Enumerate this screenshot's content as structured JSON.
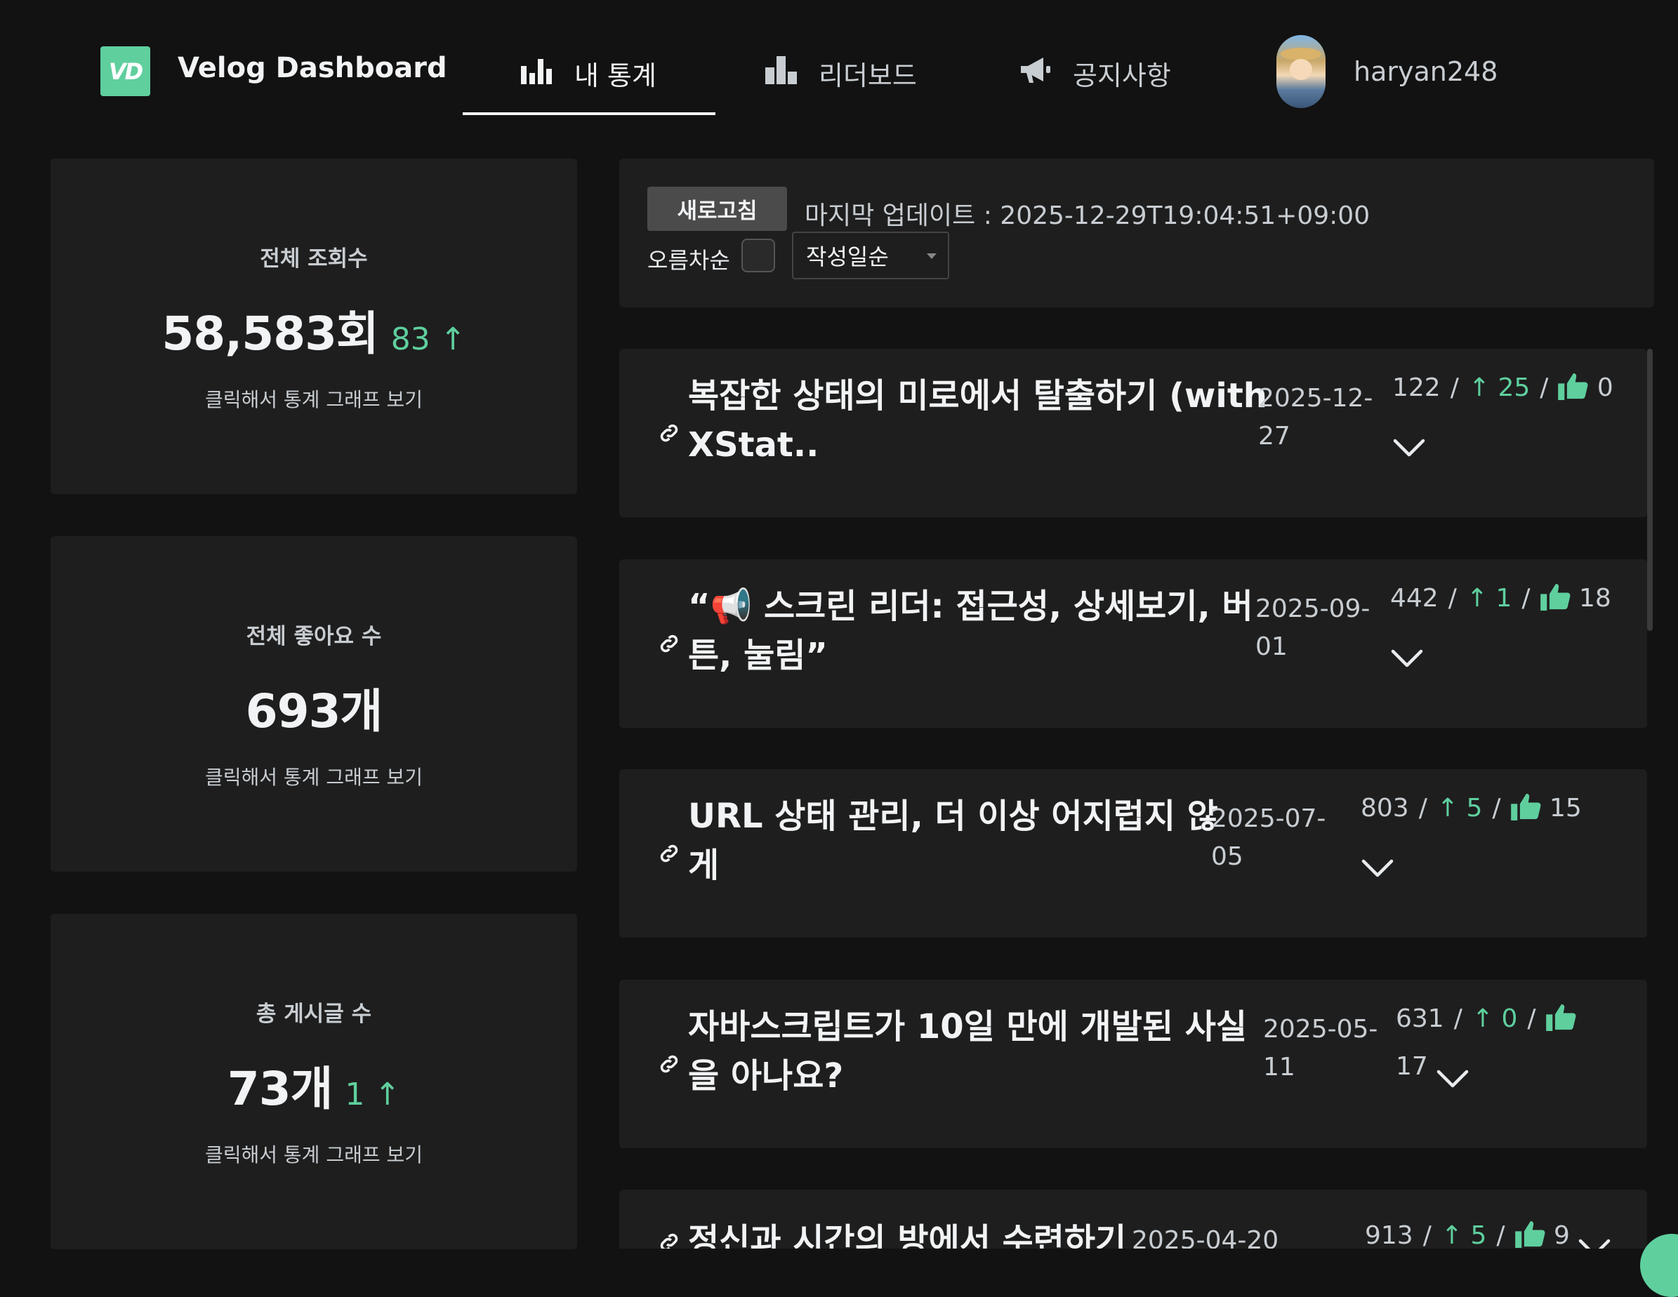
{
  "header": {
    "logo": "VD",
    "brand": "Velog Dashboard",
    "nav": [
      {
        "label": "내 통계",
        "icon": "bar-chart-icon"
      },
      {
        "label": "리더보드",
        "icon": "leaderboard-icon"
      },
      {
        "label": "공지사항",
        "icon": "megaphone-icon"
      }
    ],
    "username": "haryan248"
  },
  "stats": {
    "views": {
      "title": "전체 조회수",
      "value": "58,583회",
      "delta": "83 ↑",
      "hint": "클릭해서 통계 그래프 보기"
    },
    "likes": {
      "title": "전체 좋아요 수",
      "value": "693개",
      "hint": "클릭해서 통계 그래프 보기"
    },
    "posts": {
      "title": "총 게시글 수",
      "value": "73개",
      "delta": "1 ↑",
      "hint": "클릭해서 통계 그래프 보기"
    }
  },
  "controls": {
    "refresh_label": "새로고침",
    "last_update": "마지막 업데이트 : 2025-12-29T19:04:51+09:00",
    "asc_label": "오름차순",
    "sort_value": "작성일순"
  },
  "posts": [
    {
      "title_line1": "복잡한 상태의 미로에서 탈출하기 (with",
      "title_line2": "XStat..",
      "date_line1": "2025-12-",
      "date_line2": "27",
      "views": "122",
      "daily": "↑ 25",
      "likes": "0"
    },
    {
      "title_line1": "“📢 스크린 리더: 접근성, 상세보기, 버",
      "title_line2": "튼, 눌림”",
      "date_line1": "2025-09-",
      "date_line2": "01",
      "views": "442",
      "daily": "↑ 1",
      "likes": "18"
    },
    {
      "title_line1": "URL 상태 관리, 더 이상 어지럽지 않",
      "title_line2": "게",
      "date_line1": "2025-07-",
      "date_line2": "05",
      "views": "803",
      "daily": "↑ 5",
      "likes": "15"
    },
    {
      "title_line1": "자바스크립트가 10일 만에 개발된 사실",
      "title_line2": "을 아나요?",
      "date_line1": "2025-05-",
      "date_line2": "11",
      "views": "631",
      "daily": "↑ 0",
      "likes": "17"
    },
    {
      "title_line1": "정신과 시간의 방에서 수련하기",
      "title_line2": "",
      "date_line1": "2025-04-20",
      "date_line2": "",
      "views": "913",
      "daily": "↑ 5",
      "likes": "9"
    }
  ],
  "colors": {
    "accent": "#5fcf9e",
    "background": "#121212",
    "card": "#1e1e1e"
  }
}
